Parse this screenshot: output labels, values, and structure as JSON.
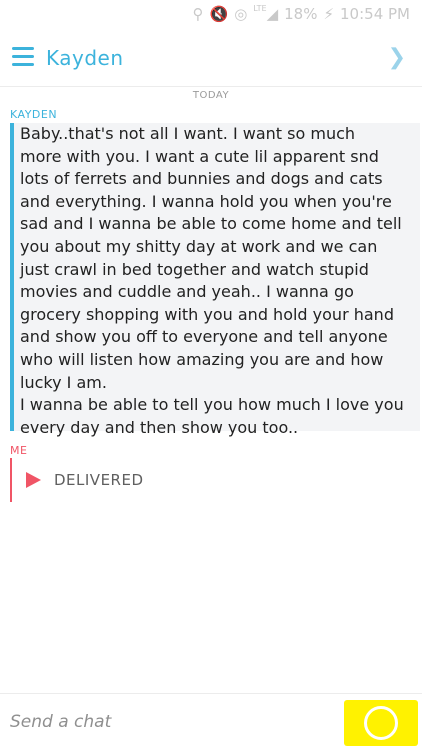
{
  "status_bar": {
    "battery": "18%",
    "time": "10:54 PM",
    "network": "LTE",
    "icons": [
      "location-icon",
      "mute-icon",
      "wifi-icon",
      "signal-icon",
      "battery-charging-icon"
    ]
  },
  "header": {
    "contact_name": "Kayden",
    "menu_icon": "hamburger-menu-icon",
    "next_icon": "chevron-right-icon"
  },
  "chat": {
    "date_label": "TODAY",
    "messages": [
      {
        "sender": "KAYDEN",
        "text": "Baby..that's not all I want. I want so much\nmore with you. I want a cute lil apparent snd\nlots of ferrets and bunnies and dogs and cats\nand everything. I wanna hold you when you're\nsad and I wanna be able to come home and tell\nyou about my shitty day at work and we can\njust crawl in bed together and watch stupid\nmovies and cuddle and yeah.. I wanna go\ngrocery shopping with you and hold your hand\nand show you off to everyone and tell anyone\nwho will listen how amazing you are and how\nlucky I am.\nI wanna be able to tell you how much I love you\nevery day and then show you too..",
        "accent": "#3cb3dc"
      },
      {
        "sender": "ME",
        "status": "DELIVERED",
        "accent": "#f05566"
      }
    ]
  },
  "input": {
    "placeholder": "Send a chat",
    "value": ""
  },
  "colors": {
    "brand_blue": "#3cb3dc",
    "me_red": "#f05566",
    "capture_yellow": "#fff200"
  }
}
